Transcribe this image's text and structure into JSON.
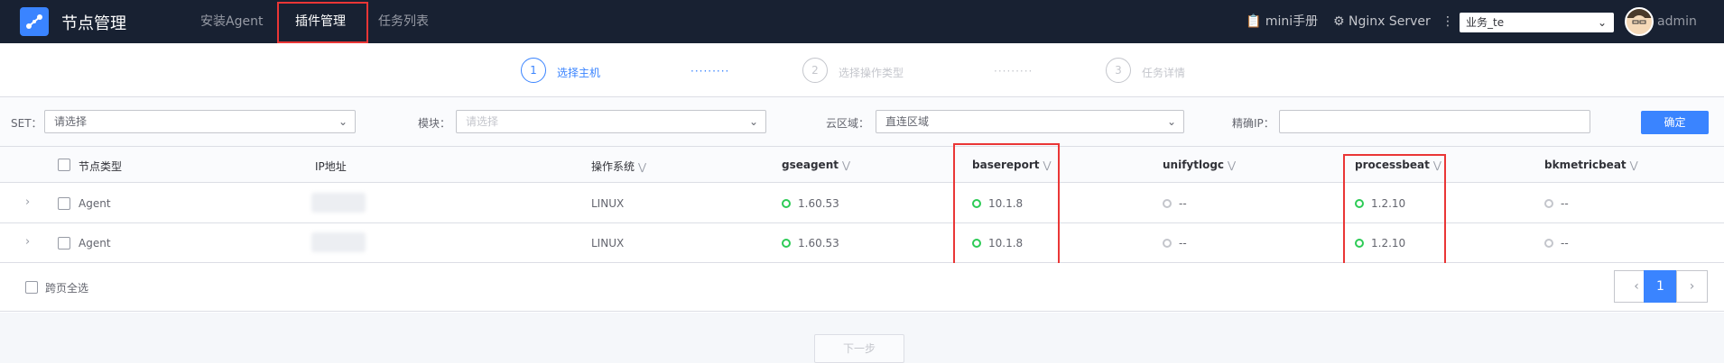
{
  "app": {
    "title": "节点管理"
  },
  "nav": [
    {
      "label": "安装Agent"
    },
    {
      "label": "插件管理"
    },
    {
      "label": "任务列表"
    }
  ],
  "topbar": {
    "manual": "mini手册",
    "server": "Nginx Server",
    "business": "业务_te",
    "user": "admin"
  },
  "steps": [
    {
      "num": "1",
      "label": "选择主机"
    },
    {
      "num": "2",
      "label": "选择操作类型"
    },
    {
      "num": "3",
      "label": "任务详情"
    }
  ],
  "filters": {
    "set_label": "SET：",
    "set_value": "请选择",
    "module_label": "模块：",
    "module_placeholder": "请选择",
    "cloud_label": "云区域：",
    "cloud_value": "直连区域",
    "ip_label": "精确IP：",
    "confirm": "确定"
  },
  "table": {
    "headers": {
      "node_type": "节点类型",
      "ip": "IP地址",
      "os": "操作系统",
      "gseagent": "gseagent",
      "basereport": "basereport",
      "unifytlogc": "unifytlogc",
      "processbeat": "processbeat",
      "bkmetricbeat": "bkmetricbeat"
    },
    "rows": [
      {
        "node_type": "Agent",
        "os": "LINUX",
        "gseagent": "1.60.53",
        "basereport": "10.1.8",
        "unifytlogc": "--",
        "processbeat": "1.2.10",
        "bkmetricbeat": "--"
      },
      {
        "node_type": "Agent",
        "os": "LINUX",
        "gseagent": "1.60.53",
        "basereport": "10.1.8",
        "unifytlogc": "--",
        "processbeat": "1.2.10",
        "bkmetricbeat": "--"
      }
    ]
  },
  "footer": {
    "select_all_pages": "跨页全选",
    "page": "1",
    "next": "下一步"
  },
  "colors": {
    "accent": "#3a84ff",
    "ok": "#2dcb56",
    "highlight": "#ea3636"
  }
}
